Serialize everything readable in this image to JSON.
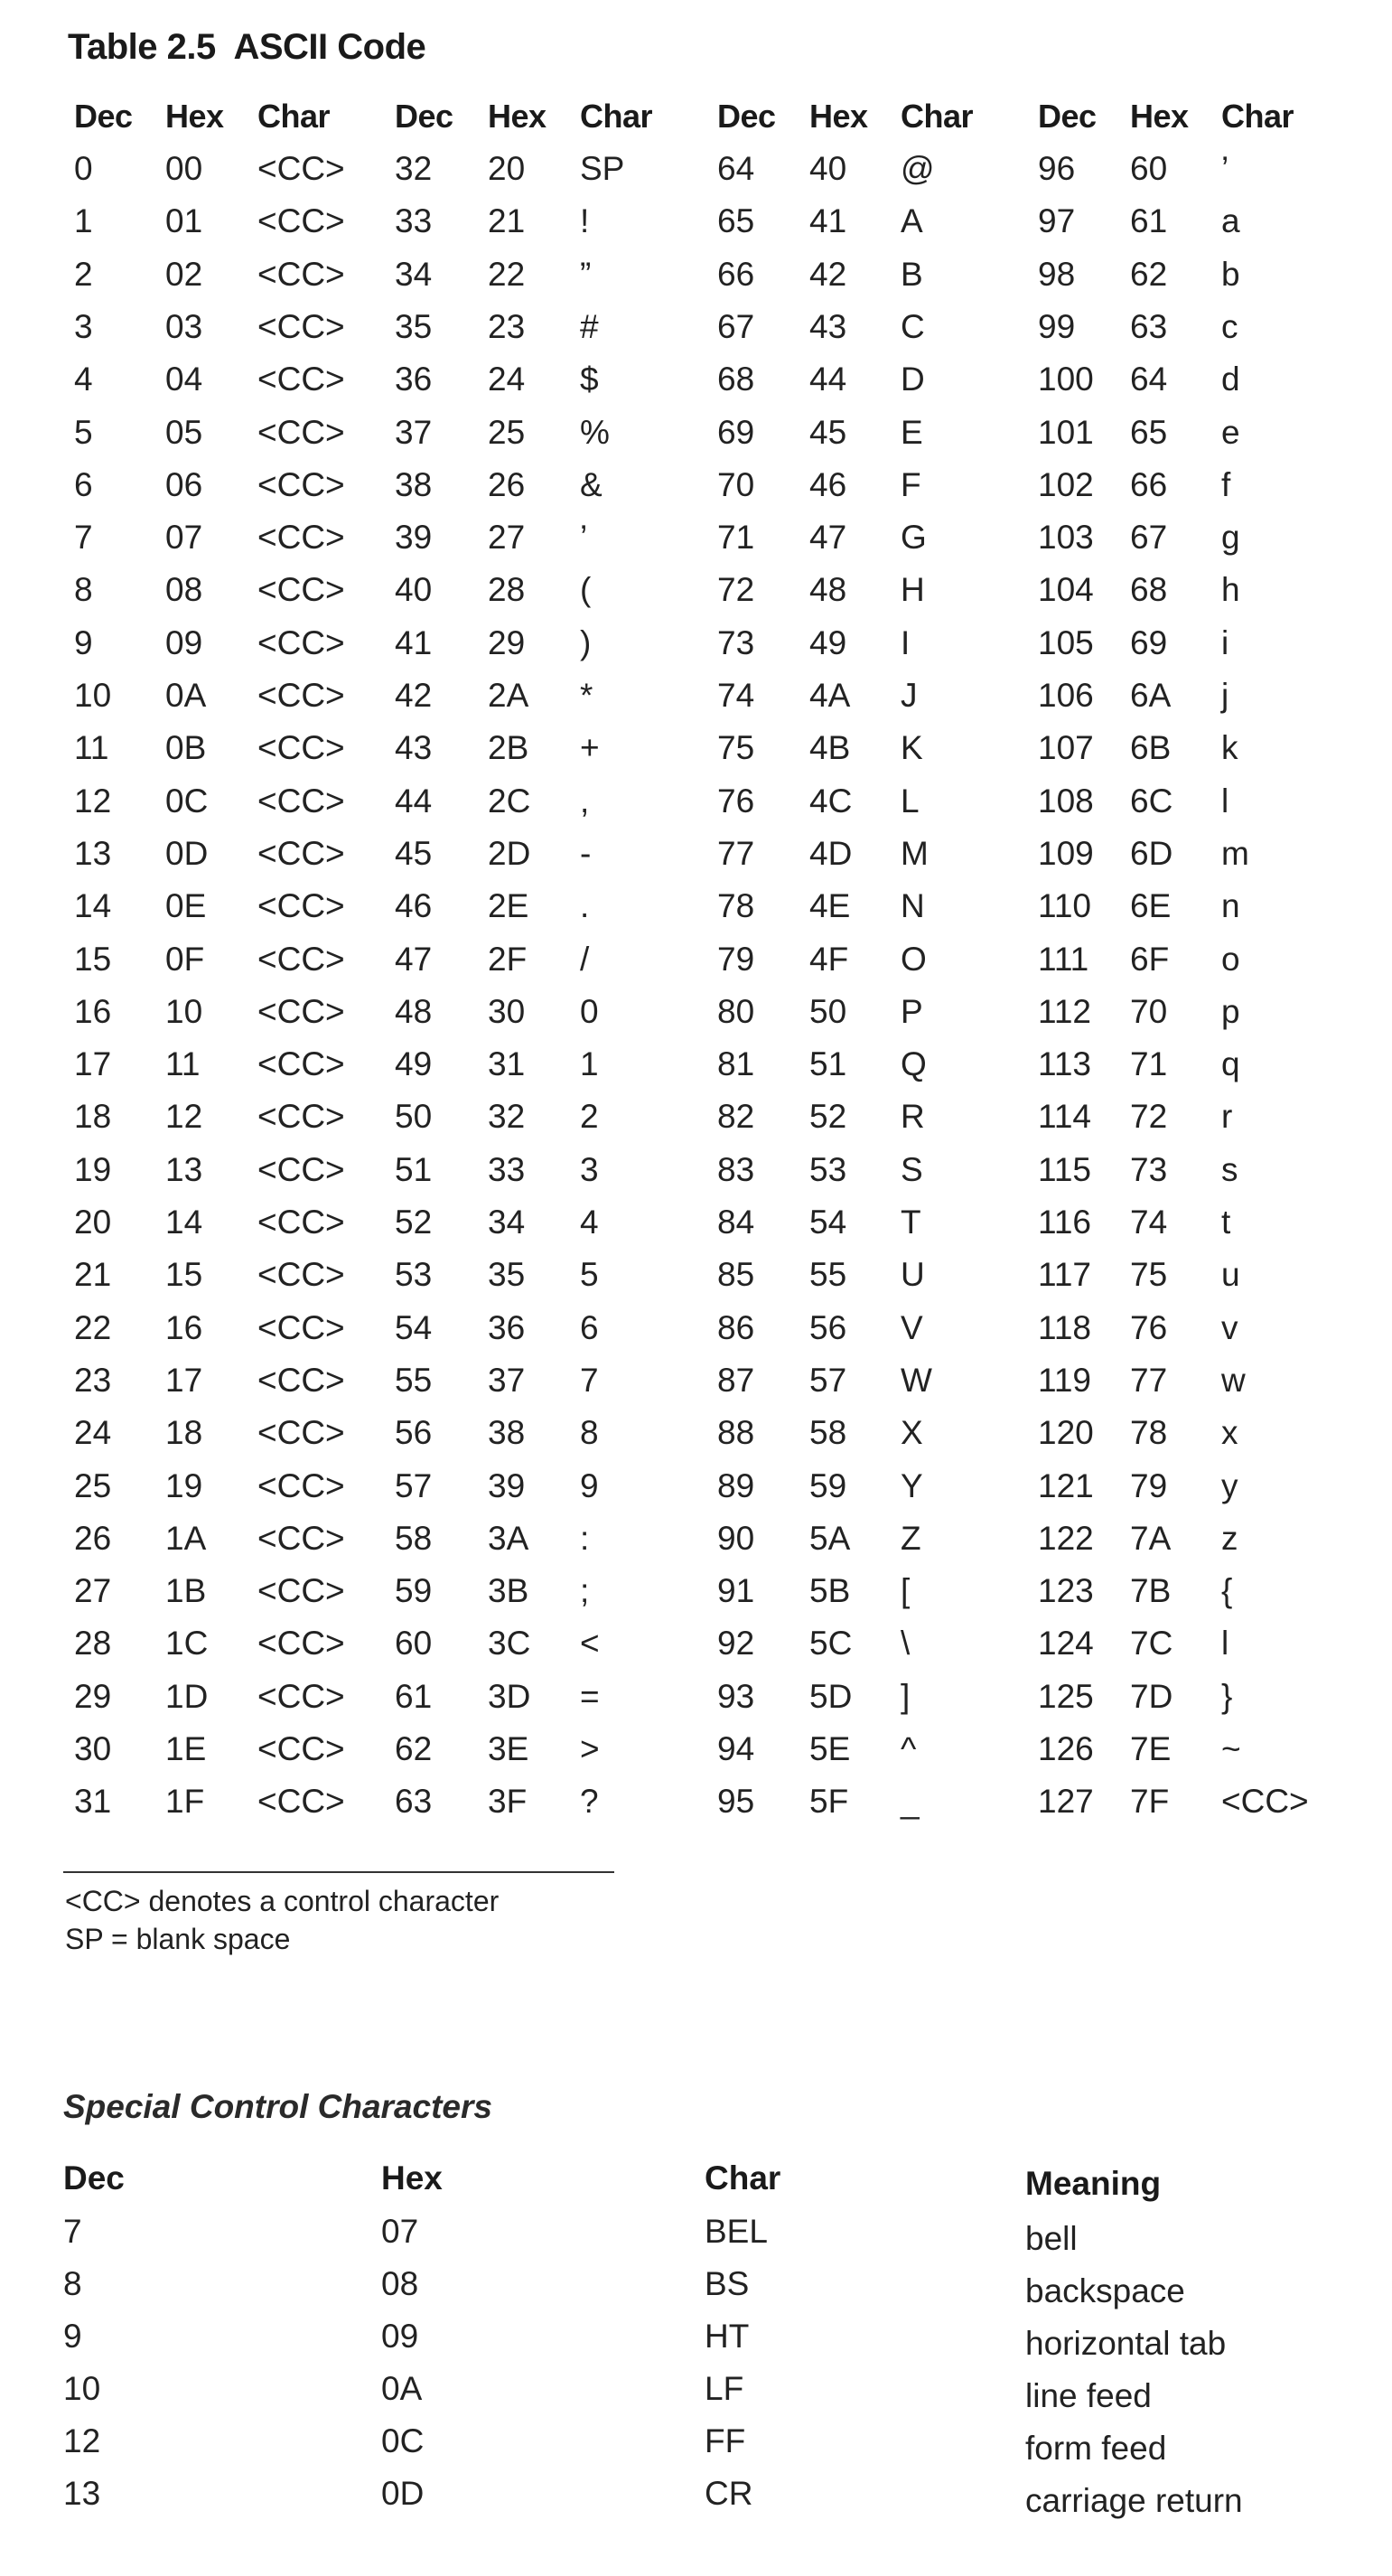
{
  "title": "Table 2.5  ASCII Code",
  "main_table": {
    "headers": [
      "Dec",
      "Hex",
      "Char"
    ],
    "groups": [
      {
        "rows": [
          [
            "0",
            "00",
            "<CC>"
          ],
          [
            "1",
            "01",
            "<CC>"
          ],
          [
            "2",
            "02",
            "<CC>"
          ],
          [
            "3",
            "03",
            "<CC>"
          ],
          [
            "4",
            "04",
            "<CC>"
          ],
          [
            "5",
            "05",
            "<CC>"
          ],
          [
            "6",
            "06",
            "<CC>"
          ],
          [
            "7",
            "07",
            "<CC>"
          ],
          [
            "8",
            "08",
            "<CC>"
          ],
          [
            "9",
            "09",
            "<CC>"
          ],
          [
            "10",
            "0A",
            "<CC>"
          ],
          [
            "11",
            "0B",
            "<CC>"
          ],
          [
            "12",
            "0C",
            "<CC>"
          ],
          [
            "13",
            "0D",
            "<CC>"
          ],
          [
            "14",
            "0E",
            "<CC>"
          ],
          [
            "15",
            "0F",
            "<CC>"
          ],
          [
            "16",
            "10",
            "<CC>"
          ],
          [
            "17",
            "11",
            "<CC>"
          ],
          [
            "18",
            "12",
            "<CC>"
          ],
          [
            "19",
            "13",
            "<CC>"
          ],
          [
            "20",
            "14",
            "<CC>"
          ],
          [
            "21",
            "15",
            "<CC>"
          ],
          [
            "22",
            "16",
            "<CC>"
          ],
          [
            "23",
            "17",
            "<CC>"
          ],
          [
            "24",
            "18",
            "<CC>"
          ],
          [
            "25",
            "19",
            "<CC>"
          ],
          [
            "26",
            "1A",
            "<CC>"
          ],
          [
            "27",
            "1B",
            "<CC>"
          ],
          [
            "28",
            "1C",
            "<CC>"
          ],
          [
            "29",
            "1D",
            "<CC>"
          ],
          [
            "30",
            "1E",
            "<CC>"
          ],
          [
            "31",
            "1F",
            "<CC>"
          ]
        ]
      },
      {
        "rows": [
          [
            "32",
            "20",
            "SP"
          ],
          [
            "33",
            "21",
            "!"
          ],
          [
            "34",
            "22",
            "”"
          ],
          [
            "35",
            "23",
            "#"
          ],
          [
            "36",
            "24",
            "$"
          ],
          [
            "37",
            "25",
            "%"
          ],
          [
            "38",
            "26",
            "&"
          ],
          [
            "39",
            "27",
            "’"
          ],
          [
            "40",
            "28",
            "("
          ],
          [
            "41",
            "29",
            ")"
          ],
          [
            "42",
            "2A",
            "*"
          ],
          [
            "43",
            "2B",
            "+"
          ],
          [
            "44",
            "2C",
            ","
          ],
          [
            "45",
            "2D",
            "-"
          ],
          [
            "46",
            "2E",
            "."
          ],
          [
            "47",
            "2F",
            "/"
          ],
          [
            "48",
            "30",
            "0"
          ],
          [
            "49",
            "31",
            "1"
          ],
          [
            "50",
            "32",
            "2"
          ],
          [
            "51",
            "33",
            "3"
          ],
          [
            "52",
            "34",
            "4"
          ],
          [
            "53",
            "35",
            "5"
          ],
          [
            "54",
            "36",
            "6"
          ],
          [
            "55",
            "37",
            "7"
          ],
          [
            "56",
            "38",
            "8"
          ],
          [
            "57",
            "39",
            "9"
          ],
          [
            "58",
            "3A",
            ":"
          ],
          [
            "59",
            "3B",
            ";"
          ],
          [
            "60",
            "3C",
            "<"
          ],
          [
            "61",
            "3D",
            "="
          ],
          [
            "62",
            "3E",
            ">"
          ],
          [
            "63",
            "3F",
            "?"
          ]
        ]
      },
      {
        "rows": [
          [
            "64",
            "40",
            "@"
          ],
          [
            "65",
            "41",
            "A"
          ],
          [
            "66",
            "42",
            "B"
          ],
          [
            "67",
            "43",
            "C"
          ],
          [
            "68",
            "44",
            "D"
          ],
          [
            "69",
            "45",
            "E"
          ],
          [
            "70",
            "46",
            "F"
          ],
          [
            "71",
            "47",
            "G"
          ],
          [
            "72",
            "48",
            "H"
          ],
          [
            "73",
            "49",
            "I"
          ],
          [
            "74",
            "4A",
            "J"
          ],
          [
            "75",
            "4B",
            "K"
          ],
          [
            "76",
            "4C",
            "L"
          ],
          [
            "77",
            "4D",
            "M"
          ],
          [
            "78",
            "4E",
            "N"
          ],
          [
            "79",
            "4F",
            "O"
          ],
          [
            "80",
            "50",
            "P"
          ],
          [
            "81",
            "51",
            "Q"
          ],
          [
            "82",
            "52",
            "R"
          ],
          [
            "83",
            "53",
            "S"
          ],
          [
            "84",
            "54",
            "T"
          ],
          [
            "85",
            "55",
            "U"
          ],
          [
            "86",
            "56",
            "V"
          ],
          [
            "87",
            "57",
            "W"
          ],
          [
            "88",
            "58",
            "X"
          ],
          [
            "89",
            "59",
            "Y"
          ],
          [
            "90",
            "5A",
            "Z"
          ],
          [
            "91",
            "5B",
            "["
          ],
          [
            "92",
            "5C",
            "\\"
          ],
          [
            "93",
            "5D",
            "]"
          ],
          [
            "94",
            "5E",
            "^"
          ],
          [
            "95",
            "5F",
            "_"
          ]
        ]
      },
      {
        "rows": [
          [
            "96",
            "60",
            "’"
          ],
          [
            "97",
            "61",
            "a"
          ],
          [
            "98",
            "62",
            "b"
          ],
          [
            "99",
            "63",
            "c"
          ],
          [
            "100",
            "64",
            "d"
          ],
          [
            "101",
            "65",
            "e"
          ],
          [
            "102",
            "66",
            "f"
          ],
          [
            "103",
            "67",
            "g"
          ],
          [
            "104",
            "68",
            "h"
          ],
          [
            "105",
            "69",
            "i"
          ],
          [
            "106",
            "6A",
            "j"
          ],
          [
            "107",
            "6B",
            "k"
          ],
          [
            "108",
            "6C",
            "l"
          ],
          [
            "109",
            "6D",
            "m"
          ],
          [
            "110",
            "6E",
            "n"
          ],
          [
            "111",
            "6F",
            "o"
          ],
          [
            "112",
            "70",
            "p"
          ],
          [
            "113",
            "71",
            "q"
          ],
          [
            "114",
            "72",
            "r"
          ],
          [
            "115",
            "73",
            "s"
          ],
          [
            "116",
            "74",
            "t"
          ],
          [
            "117",
            "75",
            "u"
          ],
          [
            "118",
            "76",
            "v"
          ],
          [
            "119",
            "77",
            "w"
          ],
          [
            "120",
            "78",
            "x"
          ],
          [
            "121",
            "79",
            "y"
          ],
          [
            "122",
            "7A",
            "z"
          ],
          [
            "123",
            "7B",
            "{"
          ],
          [
            "124",
            "7C",
            "l"
          ],
          [
            "125",
            "7D",
            "}"
          ],
          [
            "126",
            "7E",
            "~"
          ],
          [
            "127",
            "7F",
            "<CC>"
          ]
        ]
      }
    ]
  },
  "footnotes": [
    "<CC> denotes a control character",
    "SP = blank space"
  ],
  "special": {
    "title": "Special Control Characters",
    "headers": [
      "Dec",
      "Hex",
      "Char",
      "Meaning"
    ],
    "rows": [
      [
        "7",
        "07",
        "BEL",
        "bell"
      ],
      [
        "8",
        "08",
        "BS",
        "backspace"
      ],
      [
        "9",
        "09",
        "HT",
        "horizontal tab"
      ],
      [
        "10",
        "0A",
        "LF",
        "line feed"
      ],
      [
        "12",
        "0C",
        "FF",
        "form feed"
      ],
      [
        "13",
        "0D",
        "CR",
        "carriage return"
      ]
    ]
  }
}
